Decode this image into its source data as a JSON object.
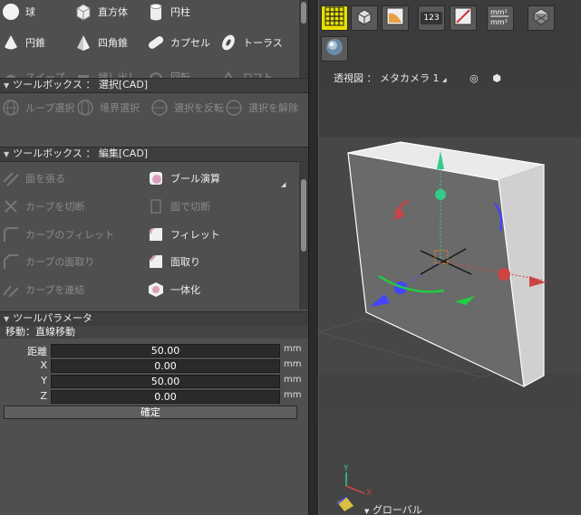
{
  "primitives": {
    "items": [
      {
        "label": "球",
        "icon": "sphere-icon"
      },
      {
        "label": "直方体",
        "icon": "cube-icon"
      },
      {
        "label": "円柱",
        "icon": "cylinder-icon"
      },
      {
        "label": "円錐",
        "icon": "cone-icon"
      },
      {
        "label": "四角錐",
        "icon": "pyramid-icon"
      },
      {
        "label": "カプセル",
        "icon": "capsule-icon"
      },
      {
        "label": "トーラス",
        "icon": "torus-icon"
      },
      {
        "label": "スイープ",
        "icon": "sweep-icon"
      },
      {
        "label": "押し出し",
        "icon": "extrude-icon"
      },
      {
        "label": "回転",
        "icon": "revolve-icon"
      },
      {
        "label": "ロフト",
        "icon": "loft-icon"
      }
    ]
  },
  "select_panel": {
    "title": "ツールボックス ： 選択[CAD]",
    "items": [
      "ループ選択",
      "境界選択",
      "選択を反転",
      "選択を解除"
    ]
  },
  "edit_panel": {
    "title": "ツールボックス ： 編集[CAD]",
    "items": [
      {
        "label": "面を張る",
        "enabled": false
      },
      {
        "label": "ブール演算",
        "enabled": true
      },
      {
        "label": "カーブを切断",
        "enabled": false
      },
      {
        "label": "面で切断",
        "enabled": false
      },
      {
        "label": "カーブのフィレット",
        "enabled": false
      },
      {
        "label": "フィレット",
        "enabled": true
      },
      {
        "label": "カーブの面取り",
        "enabled": false
      },
      {
        "label": "面取り",
        "enabled": true
      },
      {
        "label": "カーブを連結",
        "enabled": false
      },
      {
        "label": "一体化",
        "enabled": true
      }
    ]
  },
  "params": {
    "title": "ツールパラメータ",
    "section": "移動：直線移動",
    "rows": [
      {
        "label": "距離",
        "value": "50.00",
        "unit": "mm"
      },
      {
        "label": "X",
        "value": "0.00",
        "unit": "mm"
      },
      {
        "label": "Y",
        "value": "50.00",
        "unit": "mm"
      },
      {
        "label": "Z",
        "value": "0.00",
        "unit": "mm"
      }
    ],
    "confirm": "確定"
  },
  "toolbar": {
    "items": [
      {
        "icon": "snap-grid-icon",
        "active": true
      },
      {
        "icon": "view-cubes-icon",
        "active": false
      },
      {
        "icon": "render-icon",
        "active": false
      },
      {
        "icon": "numeric-input-icon",
        "label": "123",
        "active": false
      },
      {
        "icon": "measure-icon",
        "active": false
      },
      {
        "icon": "unit-mm-icon",
        "active": false
      },
      {
        "icon": "surface-check-icon",
        "active": false
      },
      {
        "icon": "material-sphere-icon",
        "active": false
      }
    ]
  },
  "viewport": {
    "title": "透視図 ： メタカメラ 1",
    "axis_y": "Y",
    "axis_x": "X",
    "coord_label": "グローバル"
  },
  "colors": {
    "accent": "#e8e000",
    "panel": "#4f4f4f",
    "header": "#3e3e3e"
  }
}
